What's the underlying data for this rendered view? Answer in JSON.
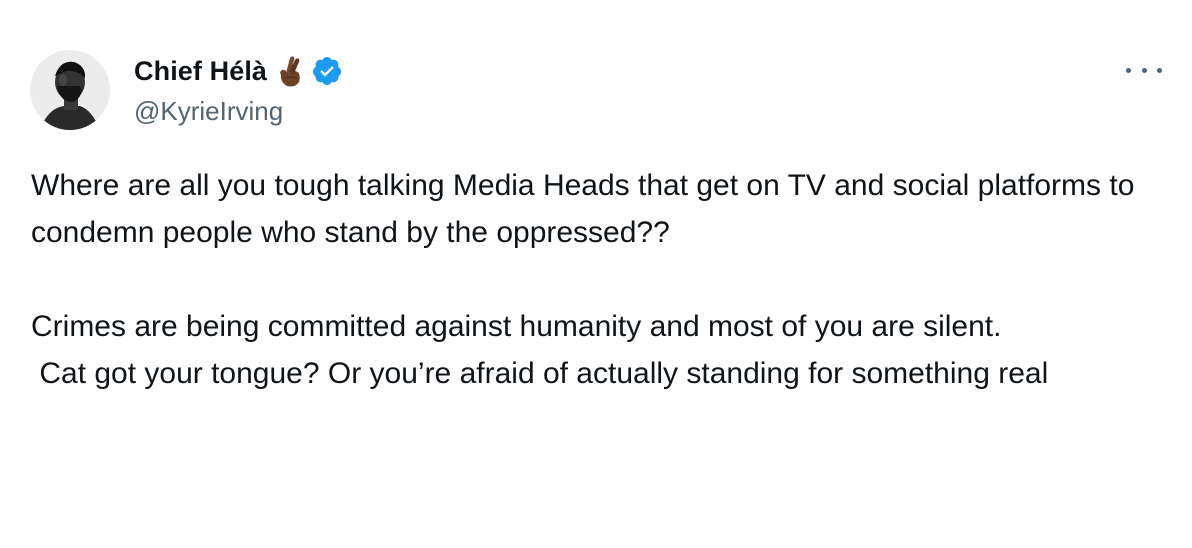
{
  "author": {
    "display_name": "Chief Hélà",
    "handle": "@KyrieIrving",
    "emoji_icon": "crossed-fingers-emoji-dark-skin",
    "verified_icon": "verified-badge",
    "verified_color": "#1d9bf0"
  },
  "more_menu": {
    "icon": "more-horizontal-icon"
  },
  "tweet": {
    "paragraphs": [
      "Where are all you tough talking Media Heads that get on TV and social platforms to condemn people who stand by the oppressed??",
      "Crimes are being committed against humanity and most of you are silent.",
      " Cat got your tongue? Or you’re afraid of actually standing for something real"
    ]
  },
  "colors": {
    "text_primary": "#0f1419",
    "text_secondary": "#536471",
    "background": "#ffffff"
  }
}
